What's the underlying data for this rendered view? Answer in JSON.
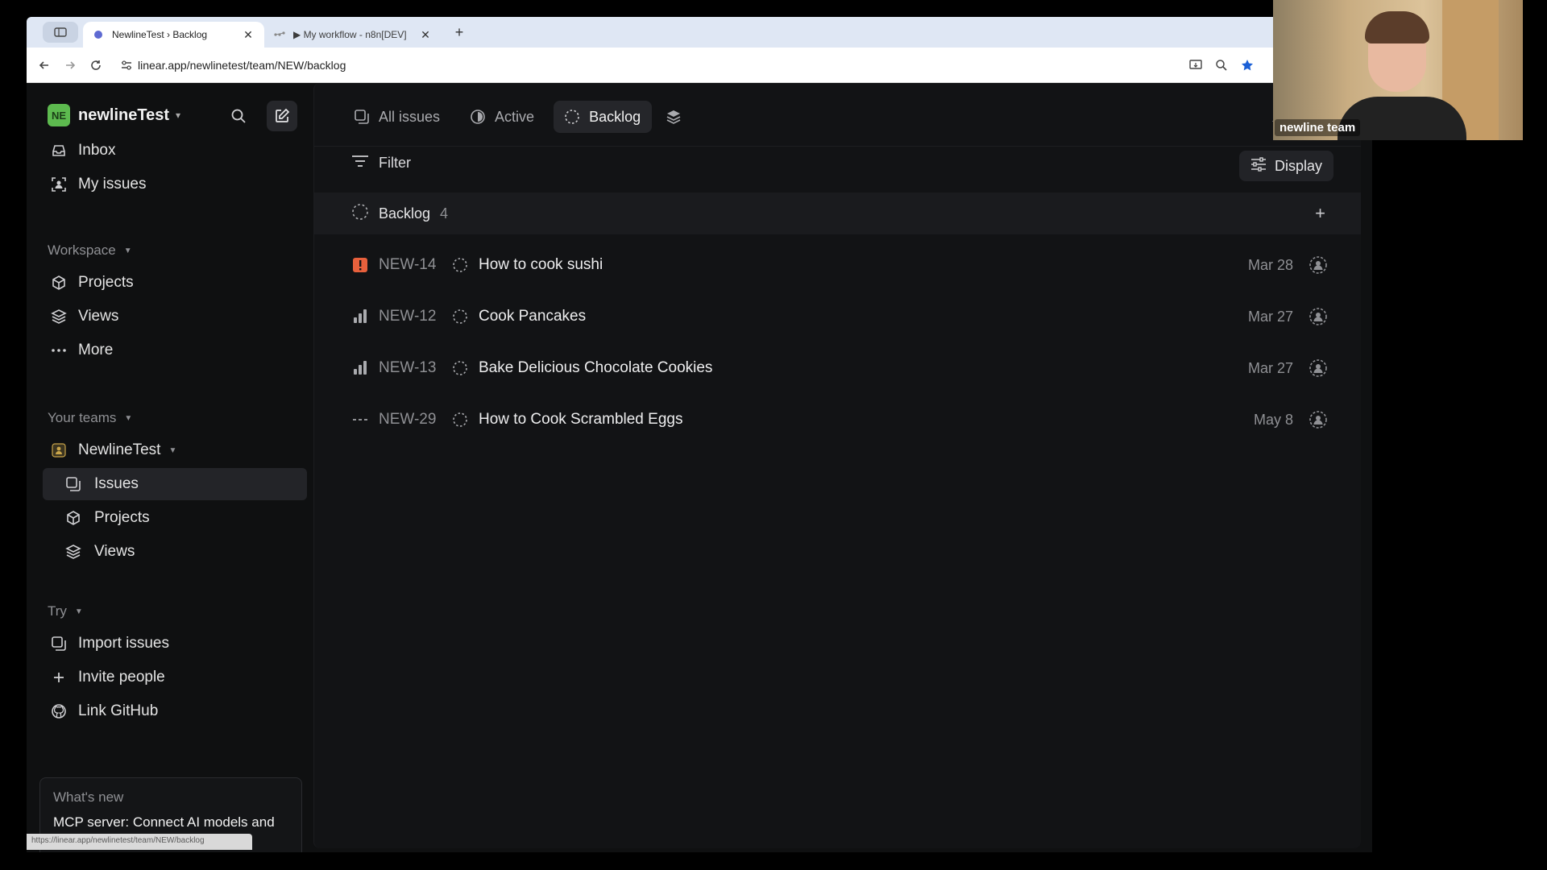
{
  "browser": {
    "tabs": [
      {
        "title": "NewlineTest › Backlog",
        "active": true
      },
      {
        "title": "▶ My workflow - n8n[DEV]",
        "active": false
      }
    ],
    "url": "linear.app/newlinetest/team/NEW/backlog",
    "status_url": "https://linear.app/newlinetest/team/NEW/backlog"
  },
  "sidebar": {
    "workspace": {
      "badge": "NE",
      "name": "newlineTest"
    },
    "top_items": [
      {
        "label": "Inbox",
        "icon": "inbox-icon"
      },
      {
        "label": "My issues",
        "icon": "my-issues-icon"
      }
    ],
    "workspace_section": {
      "title": "Workspace",
      "items": [
        {
          "label": "Projects",
          "icon": "cube-icon"
        },
        {
          "label": "Views",
          "icon": "layers-icon"
        },
        {
          "label": "More",
          "icon": "dots-icon"
        }
      ]
    },
    "teams_section": {
      "title": "Your teams",
      "team": "NewlineTest",
      "items": [
        {
          "label": "Issues",
          "selected": true
        },
        {
          "label": "Projects"
        },
        {
          "label": "Views"
        }
      ]
    },
    "try_section": {
      "title": "Try",
      "items": [
        {
          "label": "Import issues"
        },
        {
          "label": "Invite people"
        },
        {
          "label": "Link GitHub"
        }
      ]
    },
    "whats_new": {
      "title": "What's new",
      "text": "MCP server: Connect AI models and agents with Linear"
    }
  },
  "main": {
    "tabs": [
      {
        "label": "All issues"
      },
      {
        "label": "Active"
      },
      {
        "label": "Backlog",
        "active": true
      }
    ],
    "filter_label": "Filter",
    "display_label": "Display",
    "group": {
      "label": "Backlog",
      "count": "4"
    },
    "issues": [
      {
        "key": "NEW-14",
        "title": "How to cook sushi",
        "date": "Mar 28",
        "priority": "urgent"
      },
      {
        "key": "NEW-12",
        "title": "Cook Pancakes",
        "date": "Mar 27",
        "priority": "high"
      },
      {
        "key": "NEW-13",
        "title": "Bake Delicious Chocolate Cookies",
        "date": "Mar 27",
        "priority": "high"
      },
      {
        "key": "NEW-29",
        "title": "How to Cook Scrambled Eggs",
        "date": "May 8",
        "priority": "none"
      }
    ]
  },
  "webcam": {
    "name": "newline team"
  },
  "colors": {
    "accent_urgent": "#e8603c",
    "workspace_badge": "#5dba4f",
    "bg": "#0f1011"
  }
}
